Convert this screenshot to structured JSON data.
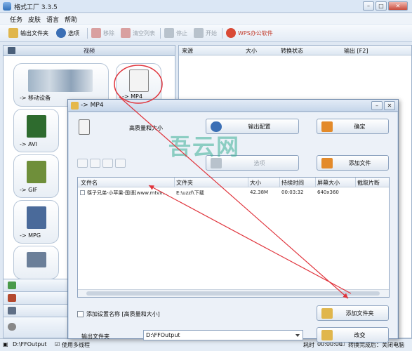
{
  "window": {
    "title": "格式工厂 3.3.5"
  },
  "menu": [
    "任务",
    "皮肤",
    "语言",
    "帮助"
  ],
  "toolbar": {
    "output_folder": "输出文件夹",
    "options": "选项",
    "remove": "移除",
    "clear_list": "清空列表",
    "stop": "停止",
    "start": "开始",
    "wps": "WPS办公软件"
  },
  "left_panel": {
    "category": "视频",
    "tiles": [
      {
        "label": "-> 移动设备"
      },
      {
        "label": "-> MP4",
        "badge": "MP4"
      },
      {
        "label": "-> AVI",
        "badge": "AVI"
      },
      {
        "label": "-> GIF",
        "badge": "GIF"
      },
      {
        "label": "-> MPG",
        "badge": "MPEG"
      }
    ],
    "categories": [
      "music-icon",
      "image-icon",
      "document-icon",
      "disc-icon"
    ]
  },
  "task_list": {
    "columns": [
      "来源",
      "大小",
      "转换状态",
      "输出 [F2]"
    ]
  },
  "statusbar": {
    "output_path": "D:\\FFOutput",
    "multithread": "使用多线程",
    "elapsed_label": "耗时",
    "elapsed_value": "00:00:00",
    "after_done": "转换完成后：关闭电脑"
  },
  "dialog": {
    "title": "-> MP4",
    "quality": "高质量和大小",
    "output_config": "输出配置",
    "ok": "确定",
    "options": "选项",
    "add_file": "添加文件",
    "file_columns": [
      "文件名",
      "文件夹",
      "大小",
      "持续时间",
      "屏幕大小",
      "截取片断"
    ],
    "files": [
      {
        "name": "筷子兄弟-小苹果-国语[www.mtvx...",
        "folder": "E:\\uzzf\\下载",
        "size": "42.38M",
        "duration": "00:03:32",
        "screen": "640x360",
        "clip": ""
      }
    ],
    "add_setting_name": "添加设置名称 [高质量和大小]",
    "add_folder": "添加文件夹",
    "output_folder_label": "输出文件夹",
    "output_folder_value": "D:\\FFOutput",
    "change": "改变"
  },
  "watermark": "吾云网",
  "colors": {
    "annotation": "#e0343c",
    "accent": "#2f6fb8"
  }
}
